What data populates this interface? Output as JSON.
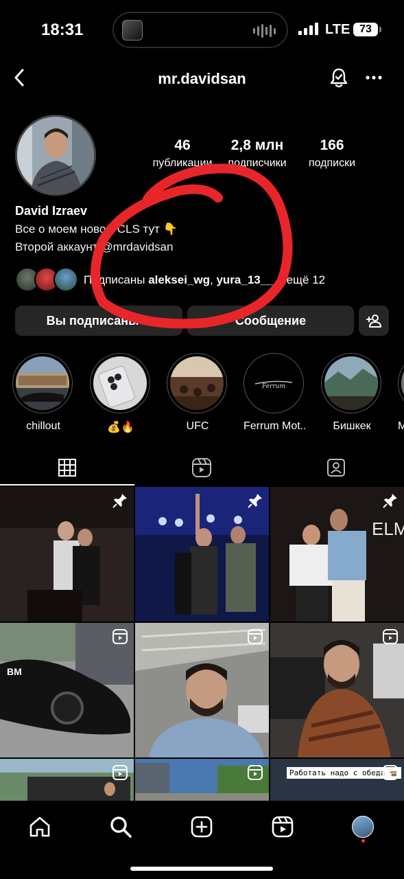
{
  "status_bar": {
    "time": "18:31",
    "network": "LTE",
    "battery": "73"
  },
  "header": {
    "username": "mr.davidsan"
  },
  "profile": {
    "stats": [
      {
        "value": "46",
        "label": "публикации"
      },
      {
        "value": "2,8 млн",
        "label": "подписчики"
      },
      {
        "value": "166",
        "label": "подписки"
      }
    ],
    "name": "David Izraev",
    "bio_line1": "Все о моем новом CLS тут 👇",
    "bio_line2": "Второй аккаунт @mrdavidsan",
    "followed_by_prefix": "Подписаны ",
    "followed_by_user1": "aleksei_wg",
    "followed_by_sep": ", ",
    "followed_by_user2": "yura_13__",
    "followed_by_suffix": " и ещё 12"
  },
  "actions": {
    "following_label": "Вы подписаны",
    "message_label": "Сообщение"
  },
  "highlights": [
    {
      "label": "chillout"
    },
    {
      "label": "💰🔥"
    },
    {
      "label": "UFC"
    },
    {
      "label": "Ferrum Mot..."
    },
    {
      "label": "Бишкек"
    },
    {
      "label": "M"
    }
  ],
  "posts": [
    {
      "badge": "pin"
    },
    {
      "badge": "pin"
    },
    {
      "badge": "pin"
    },
    {
      "badge": "reel"
    },
    {
      "badge": "reel"
    },
    {
      "badge": "reel"
    },
    {
      "badge": "reel"
    },
    {
      "badge": "reel"
    },
    {
      "badge": "reel",
      "caption": "Работать надо с обеда 🍲"
    }
  ],
  "post_texts": {
    "post3_sign": "ELMAN",
    "car_plate": "BM"
  },
  "highlight_logo_text": "Ferrum",
  "annotation_color": "#e8262a"
}
